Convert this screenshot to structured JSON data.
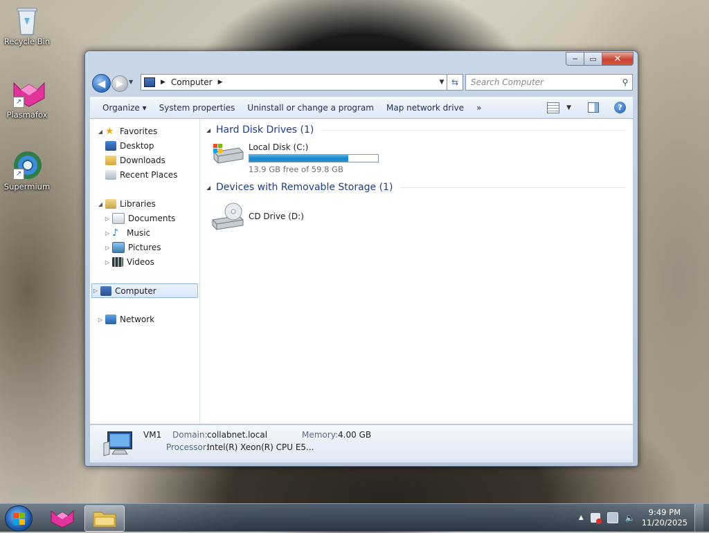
{
  "desktop": {
    "icons": [
      {
        "label": "Recycle Bin",
        "icon": "recycle-bin-icon"
      },
      {
        "label": "Plasmafox",
        "icon": "plasmafox-icon"
      },
      {
        "label": "Supermium",
        "icon": "supermium-icon"
      }
    ]
  },
  "window": {
    "address": {
      "crumb": "Computer",
      "icon": "computer-icon"
    },
    "search_placeholder": "Search Computer",
    "caption": {
      "minimize": "─",
      "maximize": "▭",
      "close": "✕"
    },
    "toolbar": {
      "organize": "Organize ▾",
      "system_properties": "System properties",
      "uninstall": "Uninstall or change a program",
      "map_drive": "Map network drive",
      "more": "»"
    },
    "nav": {
      "favorites": "Favorites",
      "desktop": "Desktop",
      "downloads": "Downloads",
      "recent": "Recent Places",
      "libraries": "Libraries",
      "documents": "Documents",
      "music": "Music",
      "pictures": "Pictures",
      "videos": "Videos",
      "computer": "Computer",
      "network": "Network"
    },
    "groups": {
      "hdd": "Hard Disk Drives (1)",
      "removable": "Devices with Removable Storage (1)"
    },
    "drives": {
      "c": {
        "name": "Local Disk (C:)",
        "free": "13.9 GB free of 59.8 GB",
        "used_fraction": 0.77
      },
      "d": {
        "name": "CD Drive (D:)"
      }
    },
    "details": {
      "name": "VM1",
      "domain_label": "Domain:",
      "domain": "collabnet.local",
      "memory_label": "Memory:",
      "memory": "4.00 GB",
      "processor_label": "Processor:",
      "processor": "Intel(R) Xeon(R) CPU E5..."
    }
  },
  "taskbar": {
    "time": "9:49 PM",
    "date": "11/20/2025",
    "tray_up": "▲"
  },
  "colors": {
    "accent": "#1e3c8a",
    "bar_fill": "#1b86c8",
    "close_button": "#c74532"
  }
}
